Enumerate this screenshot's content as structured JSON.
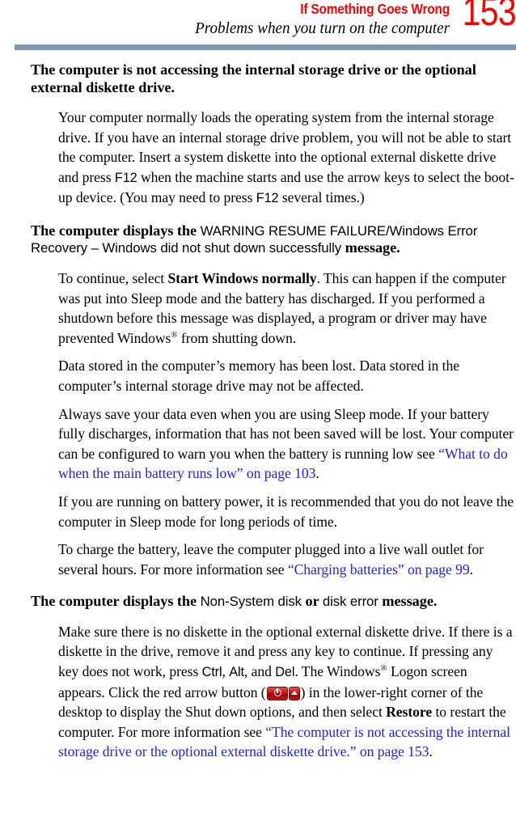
{
  "header": {
    "title": "If Something Goes Wrong",
    "subtitle": "Problems when you turn on the computer",
    "page_number": "153",
    "rule_color": "#7f96b4",
    "title_color": "#ff0000",
    "page_number_color": "#ff0000"
  },
  "link_color": "#2020e8",
  "sections": [
    {
      "heading": {
        "parts": [
          {
            "text": "The computer is not accessing the internal storage drive or the optional external diskette drive.",
            "style": "bold-serif"
          }
        ]
      },
      "paragraphs": [
        {
          "parts": [
            {
              "text": "Your computer normally loads the operating system from the internal storage drive. If you have an internal storage drive problem, you will not be able to start the computer. Insert a system diskette into the optional external diskette drive and press ",
              "style": "plain"
            },
            {
              "text": "F12",
              "style": "ui"
            },
            {
              "text": " when the machine starts and use the arrow keys to select the boot-up device. (You may need to press ",
              "style": "plain"
            },
            {
              "text": "F12",
              "style": "ui"
            },
            {
              "text": " several times.)",
              "style": "plain"
            }
          ]
        }
      ]
    },
    {
      "heading": {
        "parts": [
          {
            "text": "The computer displays the ",
            "style": "bold-serif"
          },
          {
            "text": "WARNING RESUME FAILURE/Windows Error Recovery – Windows did not shut down successfully",
            "style": "ui"
          },
          {
            "text": " message.",
            "style": "bold-serif"
          }
        ]
      },
      "paragraphs": [
        {
          "parts": [
            {
              "text": "To continue, select ",
              "style": "plain"
            },
            {
              "text": "Start Windows normally",
              "style": "bold"
            },
            {
              "text": ". This can happen if the computer was put into Sleep mode and the battery has discharged. If you performed a shutdown before this message was displayed, a program or driver may have prevented Windows",
              "style": "plain"
            },
            {
              "text": "®",
              "style": "superscript"
            },
            {
              "text": " from shutting down.",
              "style": "plain"
            }
          ]
        },
        {
          "parts": [
            {
              "text": "Data stored in the computer’s memory has been lost. Data stored in the computer’s internal storage drive may not be affected.",
              "style": "plain"
            }
          ]
        },
        {
          "parts": [
            {
              "text": "Always save your data even when you are using Sleep mode. If your battery fully discharges, information that has not been saved will be lost. Your computer can be configured to warn you when the battery is running low see ",
              "style": "plain"
            },
            {
              "text": "“What to do when the main battery runs low” on page 103",
              "style": "link"
            },
            {
              "text": ".",
              "style": "plain"
            }
          ]
        },
        {
          "parts": [
            {
              "text": "If you are running on battery power, it is recommended that you do not leave the computer in Sleep mode for long periods of time.",
              "style": "plain"
            }
          ]
        },
        {
          "parts": [
            {
              "text": "To charge the battery, leave the computer plugged into a live wall outlet for several hours. For more information see ",
              "style": "plain"
            },
            {
              "text": "“Charging batteries” on page 99",
              "style": "link"
            },
            {
              "text": ".",
              "style": "plain"
            }
          ]
        }
      ]
    },
    {
      "heading": {
        "parts": [
          {
            "text": "The computer displays the ",
            "style": "bold-serif"
          },
          {
            "text": "Non-System disk",
            "style": "ui"
          },
          {
            "text": " or ",
            "style": "bold-serif"
          },
          {
            "text": "disk error",
            "style": "ui"
          },
          {
            "text": " message.",
            "style": "bold-serif"
          }
        ]
      },
      "paragraphs": [
        {
          "parts": [
            {
              "text": "Make sure there is no diskette in the optional external diskette drive. If there is a diskette in the drive, remove it and press any key to continue. If pressing any key does not work, press ",
              "style": "plain"
            },
            {
              "text": "Ctrl",
              "style": "ui"
            },
            {
              "text": ", ",
              "style": "plain"
            },
            {
              "text": "Alt",
              "style": "ui"
            },
            {
              "text": ", and ",
              "style": "plain"
            },
            {
              "text": "Del",
              "style": "ui"
            },
            {
              "text": ". The Windows",
              "style": "plain"
            },
            {
              "text": "®",
              "style": "superscript"
            },
            {
              "text": " Logon screen appears. Click the red arrow button (",
              "style": "plain"
            },
            {
              "text": "shutdown-power-button-icon",
              "style": "icon"
            },
            {
              "text": ") in the lower-right corner of the desktop to display the Shut down options, and then select ",
              "style": "plain"
            },
            {
              "text": "Restore",
              "style": "bold"
            },
            {
              "text": " to restart the computer. For more information see ",
              "style": "plain"
            },
            {
              "text": "“The computer is not accessing the internal storage drive or the optional external diskette drive.” on page 153",
              "style": "link"
            },
            {
              "text": ".",
              "style": "plain"
            }
          ]
        }
      ]
    }
  ]
}
